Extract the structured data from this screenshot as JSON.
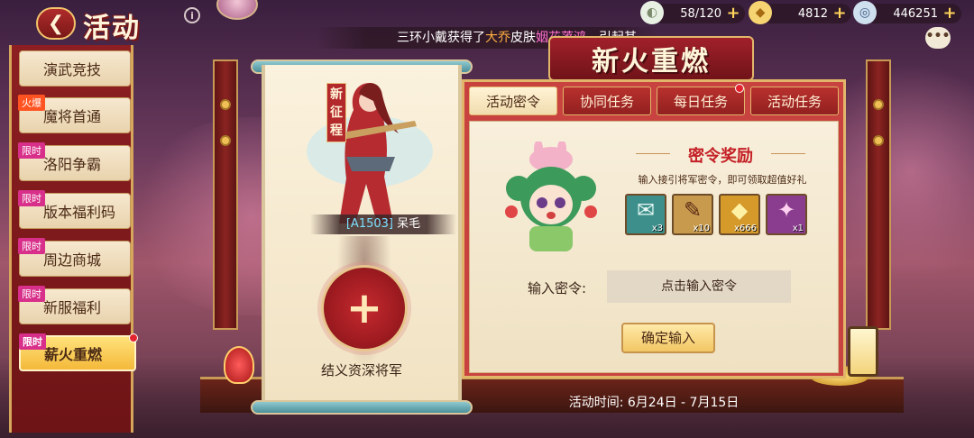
{
  "header": {
    "back_glyph": "❮",
    "title": "活动",
    "info_glyph": "i"
  },
  "resources": [
    {
      "icon": "stamina-icon",
      "glyph": "◐",
      "value": "58/120",
      "plus": "+"
    },
    {
      "icon": "gold-ingot-icon",
      "glyph": "◆",
      "value": "4812",
      "plus": "+"
    },
    {
      "icon": "coin-icon",
      "glyph": "◎",
      "value": "446251",
      "plus": "+"
    }
  ],
  "marquee": {
    "prefix": "三环小戴获得了",
    "hero": "大乔",
    "middle": "皮肤",
    "skin": "姻花落鸿",
    "suffix": "，引起其"
  },
  "chat": {
    "glyph": "•••"
  },
  "menu": {
    "items": [
      {
        "label": "演武竞技",
        "tag": ""
      },
      {
        "label": "魔将首通",
        "tag": "火爆"
      },
      {
        "label": "洛阳争霸",
        "tag": "限时"
      },
      {
        "label": "版本福利码",
        "tag": "限时"
      },
      {
        "label": "周边商城",
        "tag": "限时"
      },
      {
        "label": "新服福利",
        "tag": "限时"
      },
      {
        "label": "薪火重燃",
        "tag": "限时"
      }
    ],
    "active_index": 6
  },
  "scroll": {
    "hero_badge": "新征程",
    "hero_code": "[A1503]",
    "hero_name": "呆毛",
    "recruit_plus": "+",
    "recruit_label": "结义资深将军"
  },
  "panel": {
    "title": "新火重燃",
    "tabs": [
      "活动密令",
      "协同任务",
      "每日任务",
      "活动任务"
    ],
    "active_tab": 0,
    "reward_title": "密令奖励",
    "reward_desc": "输入接引将军密令，即可领取超值好礼",
    "rewards": [
      {
        "name": "scroll-card",
        "glyph": "✉",
        "qty": "x3",
        "bg": "#3c8f8a"
      },
      {
        "name": "summon-scroll",
        "glyph": "✎",
        "qty": "x10",
        "bg": "#c79a4d"
      },
      {
        "name": "gold-ingot",
        "glyph": "◆",
        "qty": "x666",
        "bg": "#d59a2a"
      },
      {
        "name": "event-badge",
        "glyph": "✦",
        "qty": "x1",
        "bg": "#8a3d8f"
      }
    ],
    "code_label": "输入密令:",
    "code_placeholder": "点击输入密令",
    "confirm_label": "确定输入"
  },
  "event_time": {
    "label": "活动时间:",
    "range": "6月24日 - 7月15日"
  },
  "colors": {
    "accent_red": "#c8433f",
    "gold_border": "#e2b66a",
    "parchment": "#f8efdc",
    "active_tab": "#fff3d6"
  }
}
